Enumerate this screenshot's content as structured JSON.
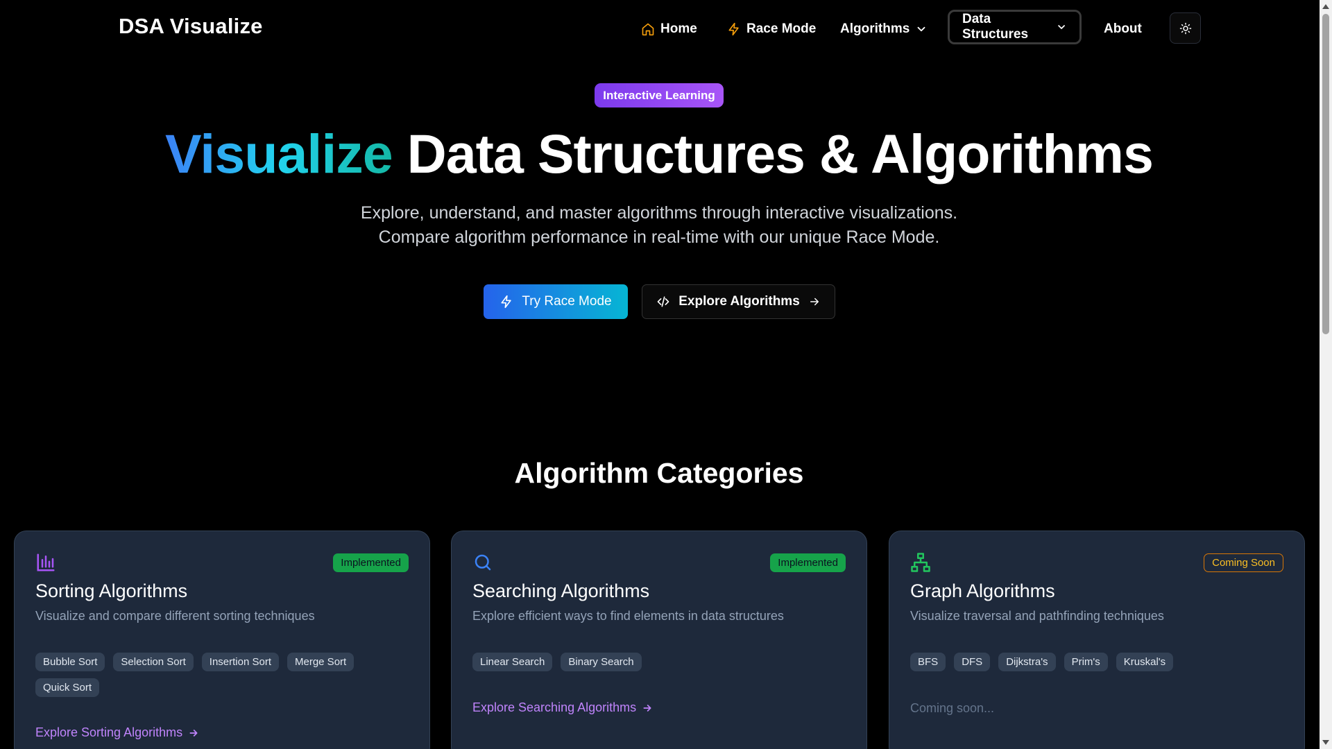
{
  "brand": "DSA Visualize",
  "nav": {
    "home": "Home",
    "race": "Race Mode",
    "algorithms": "Algorithms",
    "data_structures": "Data Structures",
    "about": "About"
  },
  "hero": {
    "badge": "Interactive Learning",
    "title_highlight": "Visualize",
    "title_rest": " Data Structures & Algorithms",
    "subtitle_line1": "Explore, understand, and master algorithms through interactive visualizations.",
    "subtitle_line2": "Compare algorithm performance in real-time with our unique Race Mode.",
    "cta_primary": "Try Race Mode",
    "cta_secondary": "Explore Algorithms"
  },
  "section_title": "Algorithm Categories",
  "cards": [
    {
      "status": "Implemented",
      "title": "Sorting Algorithms",
      "description": "Visualize and compare different sorting techniques",
      "tags": [
        "Bubble Sort",
        "Selection Sort",
        "Insertion Sort",
        "Merge Sort",
        "Quick Sort"
      ],
      "link": "Explore Sorting Algorithms"
    },
    {
      "status": "Implemented",
      "title": "Searching Algorithms",
      "description": "Explore efficient ways to find elements in data structures",
      "tags": [
        "Linear Search",
        "Binary Search"
      ],
      "link": "Explore Searching Algorithms"
    },
    {
      "status": "Coming Soon",
      "title": "Graph Algorithms",
      "description": "Visualize traversal and pathfinding techniques",
      "tags": [
        "BFS",
        "DFS",
        "Dijkstra's",
        "Prim's",
        "Kruskal's"
      ],
      "coming_soon_text": "Coming soon..."
    }
  ],
  "icons": {
    "home": "home-icon",
    "race": "lightning-icon",
    "theme": "sun-icon",
    "code": "code-icon",
    "arrow": "arrow-right-icon",
    "sorting": "bar-chart-icon",
    "searching": "search-icon",
    "graph": "network-icon"
  },
  "colors": {
    "accent_purple": "#a855f7",
    "accent_blue": "#3b82f6",
    "accent_cyan": "#06b6d4",
    "implemented": "#16a34a",
    "coming_soon": "#fbbf24",
    "link": "#c084fc",
    "card_bg": "#1e293b"
  }
}
